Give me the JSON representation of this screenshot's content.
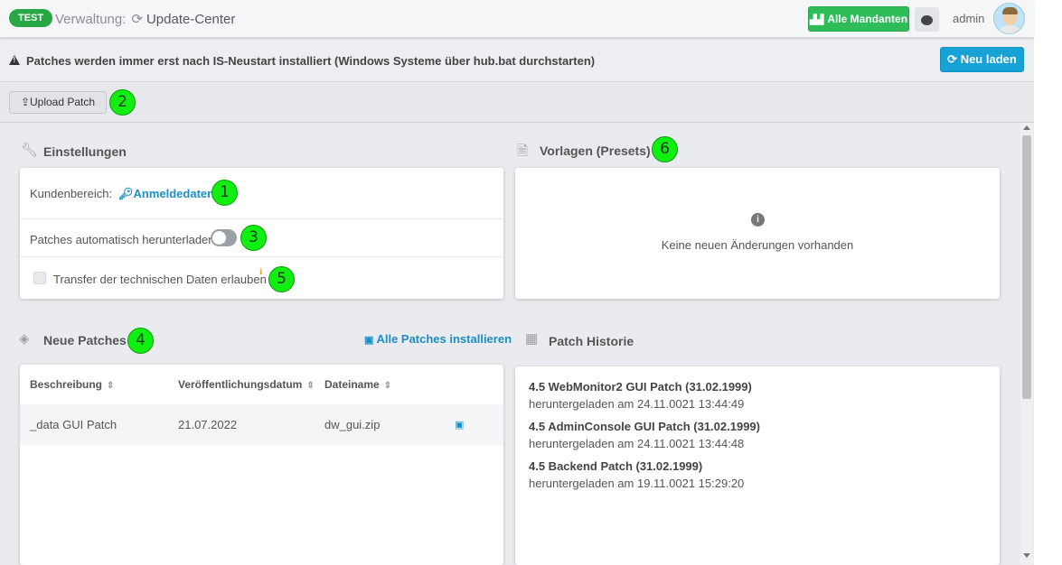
{
  "header": {
    "env_badge": "TEST",
    "section": "Verwaltung:",
    "page_title": "Update-Center",
    "mandanten_button": "Alle Mandanten",
    "username": "admin"
  },
  "warning": {
    "text": "Patches werden immer erst nach IS-Neustart installiert (Windows Systeme über hub.bat durchstarten)",
    "reload_button": "Neu laden"
  },
  "toolbar": {
    "upload_button": "Upload Patch"
  },
  "callouts": [
    "1",
    "2",
    "3",
    "4",
    "5",
    "6"
  ],
  "settings": {
    "title": "Einstellungen",
    "customer_area_label": "Kundenbereich:",
    "credentials_link": "Anmeldedaten",
    "auto_download_label": "Patches automatisch herunterladen:",
    "auto_download_enabled": false,
    "transfer_label": "Transfer der technischen Daten erlauben",
    "transfer_checked": false
  },
  "presets": {
    "title": "Vorlagen (Presets)",
    "empty_message": "Keine neuen Änderungen vorhanden"
  },
  "new_patches": {
    "title": "Neue Patches",
    "install_all_link": "Alle Patches installieren",
    "columns": [
      "Beschreibung",
      "Veröffentlichungsdatum",
      "Dateiname"
    ],
    "rows": [
      {
        "description": "_data GUI Patch",
        "date": "21.07.2022",
        "filename": "dw_gui.zip"
      }
    ]
  },
  "history": {
    "title": "Patch Historie",
    "items": [
      {
        "name": "4.5 WebMonitor2 GUI Patch (31.02.1999)",
        "downloaded": "heruntergeladen am 24.11.0021 13:44:49"
      },
      {
        "name": "4.5 AdminConsole GUI Patch (31.02.1999)",
        "downloaded": "heruntergeladen am 24.11.0021 13:44:48"
      },
      {
        "name": "4.5 Backend Patch (31.02.1999)",
        "downloaded": "heruntergeladen am 19.11.0021 15:29:20"
      }
    ]
  },
  "colors": {
    "env_badge": "#28a745",
    "mandanten_button": "#2ebd59",
    "reload_button": "#17a2d6",
    "link": "#1b8fc4",
    "callout": "#11ee11"
  },
  "icons": {
    "page": "refresh-icon",
    "mandanten": "factory-icon",
    "chat": "chat-icon",
    "warning": "warning-icon",
    "reload": "refresh-icon",
    "upload": "upload-icon",
    "settings": "wrench-icon",
    "credentials": "key-icon",
    "presets": "document-icon",
    "info": "info-icon",
    "new_patches": "layers-icon",
    "install": "install-icon",
    "history": "calendar-icon"
  }
}
